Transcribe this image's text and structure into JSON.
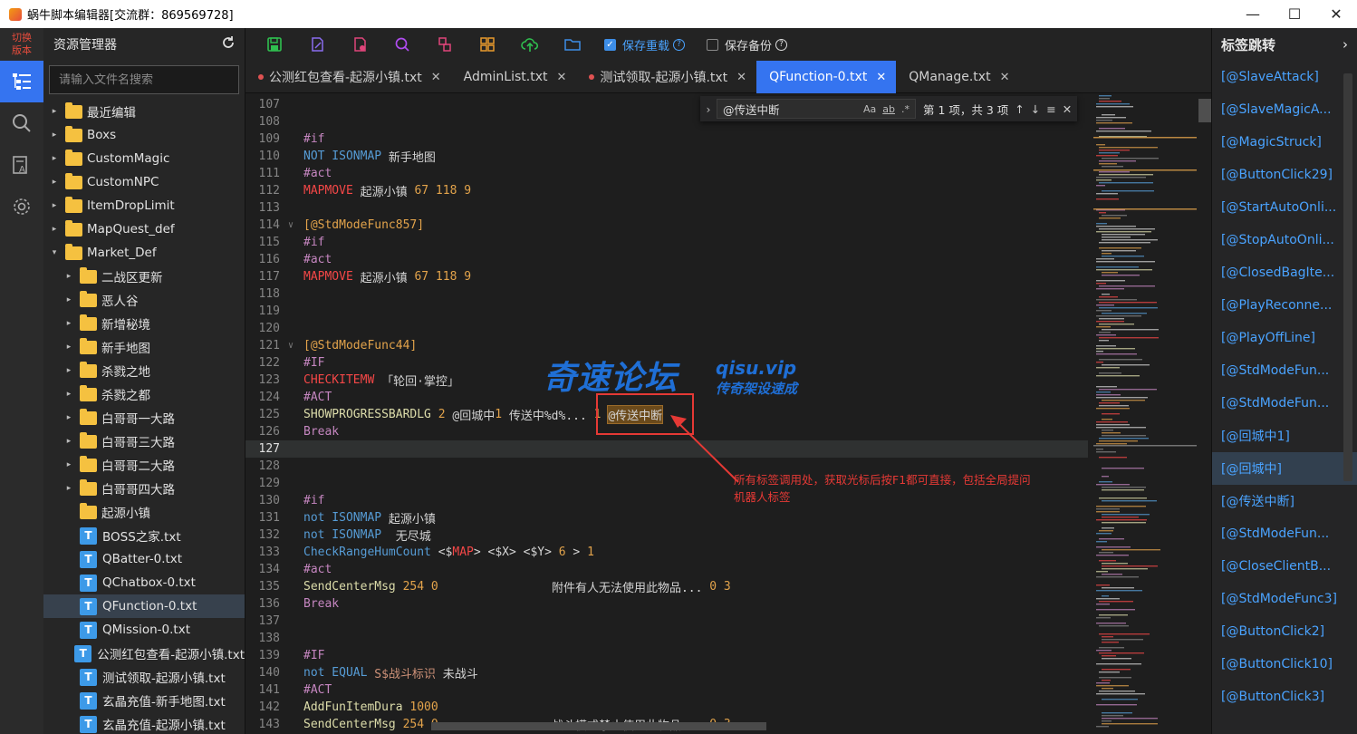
{
  "window": {
    "title": "蜗牛脚本编辑器[交流群：869569728]",
    "controls": [
      "minimize-icon",
      "maximize-icon",
      "close-icon"
    ]
  },
  "activity_bar": {
    "switch_label": "切换\n版本",
    "items": [
      {
        "icon": "explorer-icon",
        "active": true
      },
      {
        "icon": "search-icon",
        "active": false
      },
      {
        "icon": "text-format-icon",
        "active": false
      },
      {
        "icon": "settings-icon",
        "active": false
      }
    ]
  },
  "explorer": {
    "title": "资源管理器",
    "search_placeholder": "请输入文件名搜索",
    "tree": [
      {
        "label": "最近编辑",
        "type": "folder",
        "depth": 0,
        "expanded": false
      },
      {
        "label": "Boxs",
        "type": "folder",
        "depth": 0,
        "expanded": false
      },
      {
        "label": "CustomMagic",
        "type": "folder",
        "depth": 0,
        "expanded": false
      },
      {
        "label": "CustomNPC",
        "type": "folder",
        "depth": 0,
        "expanded": false
      },
      {
        "label": "ItemDropLimit",
        "type": "folder",
        "depth": 0,
        "expanded": false
      },
      {
        "label": "MapQuest_def",
        "type": "folder",
        "depth": 0,
        "expanded": false
      },
      {
        "label": "Market_Def",
        "type": "folder",
        "depth": 0,
        "expanded": true
      },
      {
        "label": "二战区更新",
        "type": "folder",
        "depth": 1,
        "expanded": false
      },
      {
        "label": "恶人谷",
        "type": "folder",
        "depth": 1,
        "expanded": false
      },
      {
        "label": "新增秘境",
        "type": "folder",
        "depth": 1,
        "expanded": false
      },
      {
        "label": "新手地图",
        "type": "folder",
        "depth": 1,
        "expanded": false
      },
      {
        "label": "杀戮之地",
        "type": "folder",
        "depth": 1,
        "expanded": false
      },
      {
        "label": "杀戮之都",
        "type": "folder",
        "depth": 1,
        "expanded": false
      },
      {
        "label": "白哥哥一大路",
        "type": "folder",
        "depth": 1,
        "expanded": false
      },
      {
        "label": "白哥哥三大路",
        "type": "folder",
        "depth": 1,
        "expanded": false
      },
      {
        "label": "白哥哥二大路",
        "type": "folder",
        "depth": 1,
        "expanded": false
      },
      {
        "label": "白哥哥四大路",
        "type": "folder",
        "depth": 1,
        "expanded": false
      },
      {
        "label": "起源小镇",
        "type": "folder",
        "depth": 1,
        "expanded": false,
        "no_arrow": true
      },
      {
        "label": "BOSS之家.txt",
        "type": "file",
        "depth": 1
      },
      {
        "label": "QBatter-0.txt",
        "type": "file",
        "depth": 1
      },
      {
        "label": "QChatbox-0.txt",
        "type": "file",
        "depth": 1
      },
      {
        "label": "QFunction-0.txt",
        "type": "file",
        "depth": 1,
        "selected": true
      },
      {
        "label": "QMission-0.txt",
        "type": "file",
        "depth": 1
      },
      {
        "label": "公测红包查看-起源小镇.txt",
        "type": "file",
        "depth": 1
      },
      {
        "label": "测试领取-起源小镇.txt",
        "type": "file",
        "depth": 1
      },
      {
        "label": "玄晶充值-新手地图.txt",
        "type": "file",
        "depth": 1
      },
      {
        "label": "玄晶充值-起源小镇.txt",
        "type": "file",
        "depth": 1
      }
    ]
  },
  "toolbar": {
    "buttons": [
      {
        "icon": "save-icon",
        "color": "#2fbf4f"
      },
      {
        "icon": "edit-file-icon",
        "color": "#8a6cf0"
      },
      {
        "icon": "delete-file-icon",
        "color": "#e0457b"
      },
      {
        "icon": "search-icon",
        "color": "#b04cf0"
      },
      {
        "icon": "replace-icon",
        "color": "#e0457b"
      },
      {
        "icon": "grid-icon",
        "color": "#e89a2c"
      },
      {
        "icon": "upload-cloud-icon",
        "color": "#2fbf4f"
      },
      {
        "icon": "folder-open-icon",
        "color": "#3d8ee8"
      }
    ],
    "save_reload_label": "保存重载",
    "save_reload_checked": true,
    "save_backup_label": "保存备份",
    "save_backup_checked": false
  },
  "tabs": [
    {
      "label": "公测红包查看-起源小镇.txt",
      "modified": true,
      "active": false
    },
    {
      "label": "AdminList.txt",
      "modified": false,
      "active": false
    },
    {
      "label": "测试领取-起源小镇.txt",
      "modified": true,
      "active": false
    },
    {
      "label": "QFunction-0.txt",
      "modified": false,
      "active": true
    },
    {
      "label": "QManage.txt",
      "modified": false,
      "active": false
    }
  ],
  "find_widget": {
    "query": "@传送中断",
    "option_case": "Aa",
    "option_word": "ab",
    "option_regex": ".*",
    "result_text": "第 1 项，共 3 项"
  },
  "editor": {
    "current_line": 127,
    "lines": [
      {
        "n": 107,
        "tokens": []
      },
      {
        "n": 108,
        "tokens": []
      },
      {
        "n": 109,
        "tokens": [
          [
            "kw-pp",
            "#if"
          ]
        ]
      },
      {
        "n": 110,
        "tokens": [
          [
            "kw-blue",
            "NOT ISONMAP"
          ],
          [
            "t",
            " 新手地图"
          ]
        ]
      },
      {
        "n": 111,
        "tokens": [
          [
            "kw-pp",
            "#act"
          ]
        ]
      },
      {
        "n": 112,
        "tokens": [
          [
            "kw-red",
            "MAPMOVE"
          ],
          [
            "t",
            " 起源小镇 "
          ],
          [
            "num",
            "67 118 9"
          ]
        ]
      },
      {
        "n": 113,
        "tokens": []
      },
      {
        "n": 114,
        "fold": true,
        "tokens": [
          [
            "lbl",
            "[@StdModeFunc857]"
          ]
        ]
      },
      {
        "n": 115,
        "tokens": [
          [
            "kw-pp",
            "#if"
          ]
        ]
      },
      {
        "n": 116,
        "tokens": [
          [
            "kw-pp",
            "#act"
          ]
        ]
      },
      {
        "n": 117,
        "tokens": [
          [
            "kw-red",
            "MAPMOVE"
          ],
          [
            "t",
            " 起源小镇 "
          ],
          [
            "num",
            "67 118 9"
          ]
        ]
      },
      {
        "n": 118,
        "tokens": []
      },
      {
        "n": 119,
        "tokens": []
      },
      {
        "n": 120,
        "tokens": []
      },
      {
        "n": 121,
        "fold": true,
        "tokens": [
          [
            "lbl",
            "[@StdModeFunc44]"
          ]
        ]
      },
      {
        "n": 122,
        "tokens": [
          [
            "kw-pp",
            "#IF"
          ]
        ]
      },
      {
        "n": 123,
        "tokens": [
          [
            "kw-red",
            "CHECKITEMW"
          ],
          [
            "t",
            " 「轮回·掌控」"
          ]
        ]
      },
      {
        "n": 124,
        "tokens": [
          [
            "kw-pp",
            "#ACT"
          ]
        ]
      },
      {
        "n": 125,
        "tokens": [
          [
            "kw-yel",
            "SHOWPROGRESSBARDLG"
          ],
          [
            "t",
            " "
          ],
          [
            "num",
            "2"
          ],
          [
            "t",
            " @回城中"
          ],
          [
            "num",
            "1"
          ],
          [
            "t",
            " 传送中%d%... "
          ],
          [
            "num",
            "1"
          ],
          [
            "t",
            " "
          ],
          [
            "hl",
            "@传送中断"
          ]
        ]
      },
      {
        "n": 126,
        "tokens": [
          [
            "kw-pp",
            "Break"
          ]
        ]
      },
      {
        "n": 127,
        "tokens": []
      },
      {
        "n": 128,
        "tokens": []
      },
      {
        "n": 129,
        "tokens": []
      },
      {
        "n": 130,
        "tokens": [
          [
            "kw-pp",
            "#if"
          ]
        ]
      },
      {
        "n": 131,
        "tokens": [
          [
            "kw-blue",
            "not ISONMAP"
          ],
          [
            "t",
            " 起源小镇"
          ]
        ]
      },
      {
        "n": 132,
        "tokens": [
          [
            "kw-blue",
            "not ISONMAP"
          ],
          [
            "t",
            "  无尽城"
          ]
        ]
      },
      {
        "n": 133,
        "tokens": [
          [
            "kw-blue",
            "CheckRangeHumCount"
          ],
          [
            "t",
            " <$"
          ],
          [
            "kw-red",
            "MAP"
          ],
          [
            "t",
            "> <$X> <$Y> "
          ],
          [
            "num",
            "6"
          ],
          [
            "t",
            " > "
          ],
          [
            "num",
            "1"
          ]
        ]
      },
      {
        "n": 134,
        "tokens": [
          [
            "kw-pp",
            "#act"
          ]
        ]
      },
      {
        "n": 135,
        "tokens": [
          [
            "kw-yel",
            "SendCenterMsg"
          ],
          [
            "t",
            " "
          ],
          [
            "num",
            "254 0"
          ],
          [
            "t",
            "                附件有人无法使用此物品... "
          ],
          [
            "num",
            "0 3"
          ]
        ]
      },
      {
        "n": 136,
        "tokens": [
          [
            "kw-pp",
            "Break"
          ]
        ]
      },
      {
        "n": 137,
        "tokens": []
      },
      {
        "n": 138,
        "tokens": []
      },
      {
        "n": 139,
        "tokens": [
          [
            "kw-pp",
            "#IF"
          ]
        ]
      },
      {
        "n": 140,
        "tokens": [
          [
            "kw-blue",
            "not EQUAL"
          ],
          [
            "t",
            " "
          ],
          [
            "kw-orange",
            "S$战斗标识"
          ],
          [
            "t",
            " 未战斗"
          ]
        ]
      },
      {
        "n": 141,
        "tokens": [
          [
            "kw-pp",
            "#ACT"
          ]
        ]
      },
      {
        "n": 142,
        "tokens": [
          [
            "kw-yel",
            "AddFunItemDura"
          ],
          [
            "t",
            " "
          ],
          [
            "num",
            "1000"
          ]
        ]
      },
      {
        "n": 143,
        "tokens": [
          [
            "kw-yel",
            "SendCenterMsg"
          ],
          [
            "t",
            " "
          ],
          [
            "num",
            "254 0"
          ],
          [
            "t",
            "                战斗模式禁止使用此物品... "
          ],
          [
            "num",
            "0 3"
          ]
        ]
      }
    ]
  },
  "label_panel": {
    "title": "标签跳转",
    "items": [
      {
        "label": "[@SlaveAttack]"
      },
      {
        "label": "[@SlaveMagicA..."
      },
      {
        "label": "[@MagicStruck]"
      },
      {
        "label": "[@ButtonClick29]"
      },
      {
        "label": "[@StartAutoOnli..."
      },
      {
        "label": "[@StopAutoOnli..."
      },
      {
        "label": "[@ClosedBagIte..."
      },
      {
        "label": "[@PlayReconne..."
      },
      {
        "label": "[@PlayOffLine]"
      },
      {
        "label": "[@StdModeFun..."
      },
      {
        "label": "[@StdModeFun..."
      },
      {
        "label": "[@回城中1]"
      },
      {
        "label": "[@回城中]",
        "active": true
      },
      {
        "label": "[@传送中断]"
      },
      {
        "label": "[@StdModeFun..."
      },
      {
        "label": "[@CloseClientB..."
      },
      {
        "label": "[@StdModeFunc3]"
      },
      {
        "label": "[@ButtonClick2]"
      },
      {
        "label": "[@ButtonClick10]"
      },
      {
        "label": "[@ButtonClick3]"
      }
    ]
  },
  "annotation": {
    "note_line1": "所有标签调用处，获取光标后按F1都可直接，包括全局提问",
    "note_line2": "机器人标签",
    "color": "#e53935"
  },
  "watermark": {
    "main": "奇速论坛",
    "url": "qisu.vip",
    "slogan": "传奇架设速成"
  },
  "colors": {
    "accent": "#3574f0",
    "label_link": "#4aa3ff",
    "folder": "#f5c140",
    "file": "#3d9ae8"
  }
}
